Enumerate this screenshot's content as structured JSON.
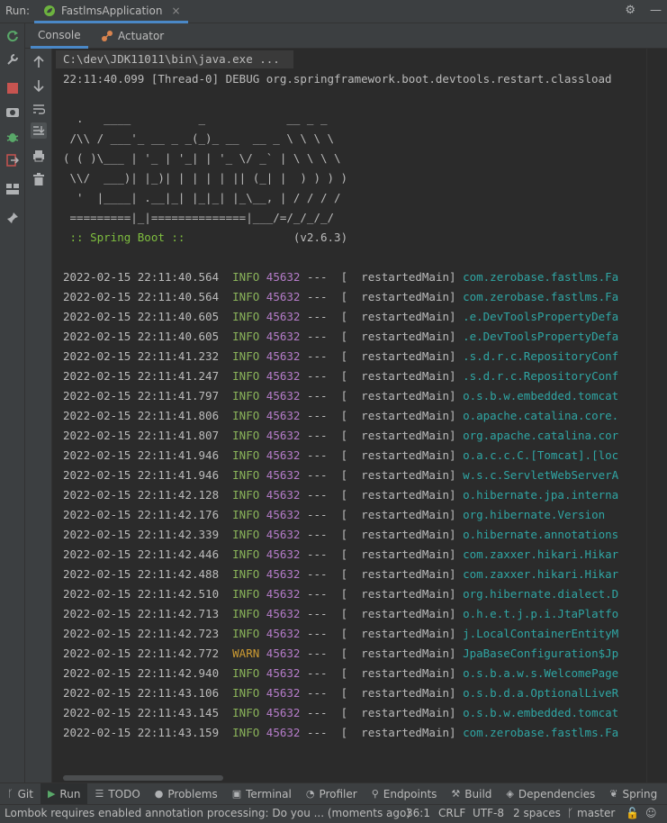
{
  "run_bar": {
    "label": "Run:",
    "tab_title": "FastlmsApplication",
    "close_glyph": "×"
  },
  "tabs": [
    {
      "label": "Console",
      "active": true
    },
    {
      "label": "Actuator",
      "active": false
    }
  ],
  "console": {
    "command": "C:\\dev\\JDK11011\\bin\\java.exe ...",
    "debug_line": "22:11:40.099 [Thread-0] DEBUG org.springframework.boot.devtools.restart.classload",
    "banner": [
      "  .   ____          _            __ _ _",
      " /\\\\ / ___'_ __ _ _(_)_ __  __ _ \\ \\ \\ \\",
      "( ( )\\___ | '_ | '_| | '_ \\/ _` | \\ \\ \\ \\",
      " \\\\/  ___)| |_)| | | | | || (_| |  ) ) ) )",
      "  '  |____| .__|_| |_|_| |_\\__, | / / / /",
      " =========|_|==============|___/=/_/_/_/"
    ],
    "spring_boot_label": " :: Spring Boot :: ",
    "spring_boot_version": "               (v2.6.3)",
    "log_entries": [
      {
        "ts": "2022-02-15 22:11:40.564",
        "level": "INFO",
        "pid": "45632",
        "thread": "---  [  restartedMain]",
        "logger": "com.zerobase.fastlms.Fa"
      },
      {
        "ts": "2022-02-15 22:11:40.564",
        "level": "INFO",
        "pid": "45632",
        "thread": "---  [  restartedMain]",
        "logger": "com.zerobase.fastlms.Fa"
      },
      {
        "ts": "2022-02-15 22:11:40.605",
        "level": "INFO",
        "pid": "45632",
        "thread": "---  [  restartedMain]",
        "logger": ".e.DevToolsPropertyDefa"
      },
      {
        "ts": "2022-02-15 22:11:40.605",
        "level": "INFO",
        "pid": "45632",
        "thread": "---  [  restartedMain]",
        "logger": ".e.DevToolsPropertyDefa"
      },
      {
        "ts": "2022-02-15 22:11:41.232",
        "level": "INFO",
        "pid": "45632",
        "thread": "---  [  restartedMain]",
        "logger": ".s.d.r.c.RepositoryConf"
      },
      {
        "ts": "2022-02-15 22:11:41.247",
        "level": "INFO",
        "pid": "45632",
        "thread": "---  [  restartedMain]",
        "logger": ".s.d.r.c.RepositoryConf"
      },
      {
        "ts": "2022-02-15 22:11:41.797",
        "level": "INFO",
        "pid": "45632",
        "thread": "---  [  restartedMain]",
        "logger": "o.s.b.w.embedded.tomcat"
      },
      {
        "ts": "2022-02-15 22:11:41.806",
        "level": "INFO",
        "pid": "45632",
        "thread": "---  [  restartedMain]",
        "logger": "o.apache.catalina.core."
      },
      {
        "ts": "2022-02-15 22:11:41.807",
        "level": "INFO",
        "pid": "45632",
        "thread": "---  [  restartedMain]",
        "logger": "org.apache.catalina.cor"
      },
      {
        "ts": "2022-02-15 22:11:41.946",
        "level": "INFO",
        "pid": "45632",
        "thread": "---  [  restartedMain]",
        "logger": "o.a.c.c.C.[Tomcat].[loc"
      },
      {
        "ts": "2022-02-15 22:11:41.946",
        "level": "INFO",
        "pid": "45632",
        "thread": "---  [  restartedMain]",
        "logger": "w.s.c.ServletWebServerA"
      },
      {
        "ts": "2022-02-15 22:11:42.128",
        "level": "INFO",
        "pid": "45632",
        "thread": "---  [  restartedMain]",
        "logger": "o.hibernate.jpa.interna"
      },
      {
        "ts": "2022-02-15 22:11:42.176",
        "level": "INFO",
        "pid": "45632",
        "thread": "---  [  restartedMain]",
        "logger": "org.hibernate.Version"
      },
      {
        "ts": "2022-02-15 22:11:42.339",
        "level": "INFO",
        "pid": "45632",
        "thread": "---  [  restartedMain]",
        "logger": "o.hibernate.annotations"
      },
      {
        "ts": "2022-02-15 22:11:42.446",
        "level": "INFO",
        "pid": "45632",
        "thread": "---  [  restartedMain]",
        "logger": "com.zaxxer.hikari.Hikar"
      },
      {
        "ts": "2022-02-15 22:11:42.488",
        "level": "INFO",
        "pid": "45632",
        "thread": "---  [  restartedMain]",
        "logger": "com.zaxxer.hikari.Hikar"
      },
      {
        "ts": "2022-02-15 22:11:42.510",
        "level": "INFO",
        "pid": "45632",
        "thread": "---  [  restartedMain]",
        "logger": "org.hibernate.dialect.D"
      },
      {
        "ts": "2022-02-15 22:11:42.713",
        "level": "INFO",
        "pid": "45632",
        "thread": "---  [  restartedMain]",
        "logger": "o.h.e.t.j.p.i.JtaPlatfo"
      },
      {
        "ts": "2022-02-15 22:11:42.723",
        "level": "INFO",
        "pid": "45632",
        "thread": "---  [  restartedMain]",
        "logger": "j.LocalContainerEntityM"
      },
      {
        "ts": "2022-02-15 22:11:42.772",
        "level": "WARN",
        "pid": "45632",
        "thread": "---  [  restartedMain]",
        "logger": "JpaBaseConfiguration$Jp"
      },
      {
        "ts": "2022-02-15 22:11:42.940",
        "level": "INFO",
        "pid": "45632",
        "thread": "---  [  restartedMain]",
        "logger": "o.s.b.a.w.s.WelcomePage"
      },
      {
        "ts": "2022-02-15 22:11:43.106",
        "level": "INFO",
        "pid": "45632",
        "thread": "---  [  restartedMain]",
        "logger": "o.s.b.d.a.OptionalLiveR"
      },
      {
        "ts": "2022-02-15 22:11:43.145",
        "level": "INFO",
        "pid": "45632",
        "thread": "---  [  restartedMain]",
        "logger": "o.s.b.w.embedded.tomcat"
      },
      {
        "ts": "2022-02-15 22:11:43.159",
        "level": "INFO",
        "pid": "45632",
        "thread": "---  [  restartedMain]",
        "logger": "com.zerobase.fastlms.Fa"
      }
    ]
  },
  "tool_windows": [
    {
      "label": "Git",
      "glyph": "ᚴ",
      "icon": "git-branch-icon"
    },
    {
      "label": "Run",
      "glyph": "▶",
      "icon": "run-icon",
      "active": true
    },
    {
      "label": "TODO",
      "glyph": "☰",
      "icon": "todo-icon"
    },
    {
      "label": "Problems",
      "glyph": "●",
      "icon": "problems-icon"
    },
    {
      "label": "Terminal",
      "glyph": "▣",
      "icon": "terminal-icon"
    },
    {
      "label": "Profiler",
      "glyph": "◔",
      "icon": "profiler-icon"
    },
    {
      "label": "Endpoints",
      "glyph": "⚲",
      "icon": "endpoints-icon"
    },
    {
      "label": "Build",
      "glyph": "⚒",
      "icon": "build-icon"
    },
    {
      "label": "Dependencies",
      "glyph": "◈",
      "icon": "dependencies-icon"
    },
    {
      "label": "Spring",
      "glyph": "❦",
      "icon": "spring-icon"
    }
  ],
  "status_bar": {
    "message": "Lombok requires enabled annotation processing: Do you ... (moments ago)",
    "position": "36:1",
    "line_separator": "CRLF",
    "encoding": "UTF-8",
    "indent": "2 spaces",
    "branch": "master"
  },
  "colors": {
    "background": "#2b2b2b",
    "panel": "#3c3f41",
    "accent": "#4a88c7",
    "info": "#8ab35a",
    "warn": "#cc9b32",
    "pid": "#b57cc9",
    "logger": "#2fa6a4"
  }
}
